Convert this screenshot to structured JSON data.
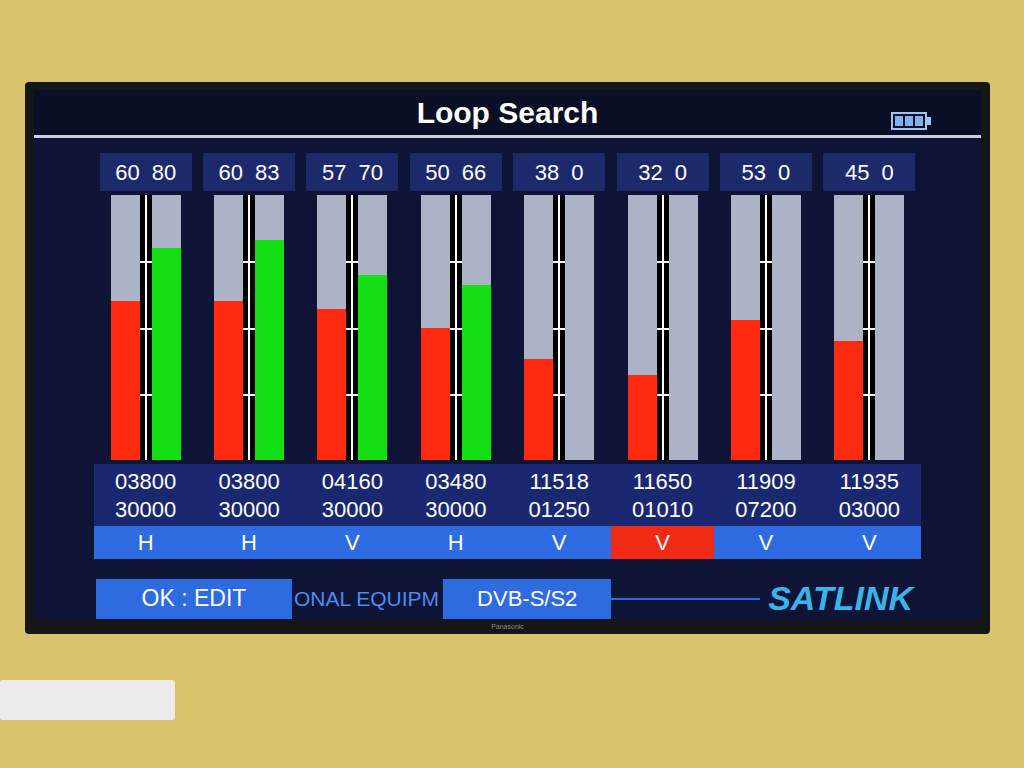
{
  "tv": {
    "brand": "Panasonic"
  },
  "screen": {
    "title": "Loop Search",
    "battery_level": 1
  },
  "channels": [
    {
      "strength": "60",
      "quality": "80",
      "strength_level": 0.6,
      "quality_level": 0.8,
      "frequency": "03800",
      "symbol_rate": "30000",
      "polarity": "H",
      "selected": false
    },
    {
      "strength": "60",
      "quality": "83",
      "strength_level": 0.6,
      "quality_level": 0.83,
      "frequency": "03800",
      "symbol_rate": "30000",
      "polarity": "H",
      "selected": false
    },
    {
      "strength": "57",
      "quality": "70",
      "strength_level": 0.57,
      "quality_level": 0.7,
      "frequency": "04160",
      "symbol_rate": "30000",
      "polarity": "V",
      "selected": false
    },
    {
      "strength": "50",
      "quality": "66",
      "strength_level": 0.5,
      "quality_level": 0.66,
      "frequency": "03480",
      "symbol_rate": "30000",
      "polarity": "H",
      "selected": false
    },
    {
      "strength": "38",
      "quality": "0",
      "strength_level": 0.38,
      "quality_level": 0,
      "frequency": "11518",
      "symbol_rate": "01250",
      "polarity": "V",
      "selected": false
    },
    {
      "strength": "32",
      "quality": "0",
      "strength_level": 0.32,
      "quality_level": 0,
      "frequency": "11650",
      "symbol_rate": "01010",
      "polarity": "V",
      "selected": true
    },
    {
      "strength": "53",
      "quality": "0",
      "strength_level": 0.53,
      "quality_level": 0,
      "frequency": "11909",
      "symbol_rate": "07200",
      "polarity": "V",
      "selected": false
    },
    {
      "strength": "45",
      "quality": "0",
      "strength_level": 0.45,
      "quality_level": 0,
      "frequency": "11935",
      "symbol_rate": "03000",
      "polarity": "V",
      "selected": false
    }
  ],
  "footer": {
    "hint": "OK : EDIT",
    "ticker": "ONAL EQUIPM",
    "mode": "DVB-S/S2",
    "logo": "SATLINK"
  }
}
